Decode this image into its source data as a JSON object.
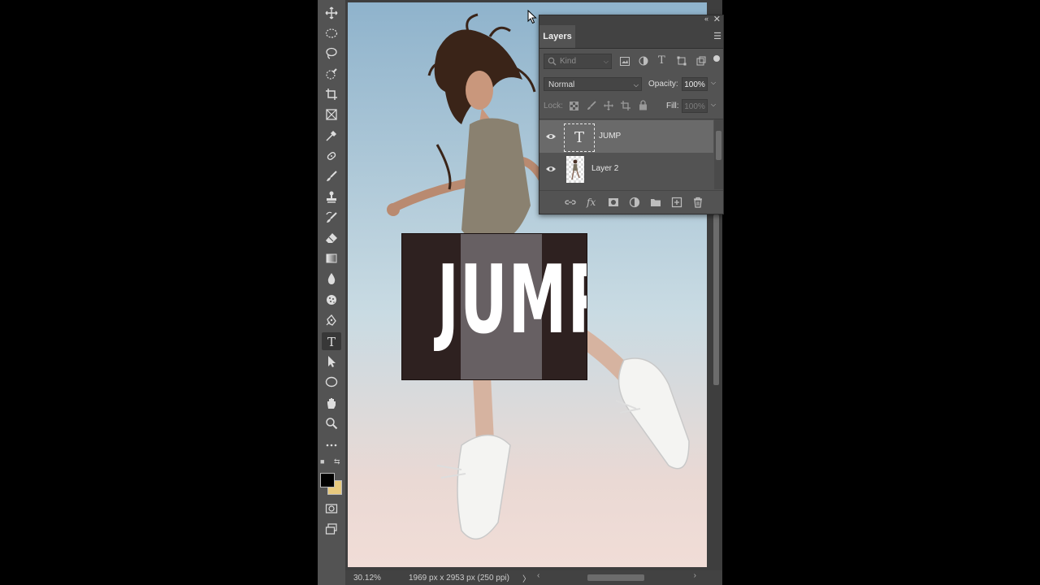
{
  "document": {
    "text_layer_content": "JUMP",
    "zoom": "30.12%",
    "doc_info": "1969 px x 2953 px (250 ppi)"
  },
  "colors": {
    "foreground": "#000000",
    "background": "#e7c97e",
    "sky_top": "#8fb3cc",
    "sky_bottom": "#f1ddd7"
  },
  "layers_panel": {
    "tab": "Layers",
    "kind_placeholder": "Kind",
    "blend_mode": "Normal",
    "opacity_label": "Opacity:",
    "opacity_value": "100%",
    "lock_label": "Lock:",
    "fill_label": "Fill:",
    "fill_value": "100%",
    "layers": [
      {
        "name": "JUMP",
        "type": "text",
        "thumb_glyph": "T",
        "visible": true,
        "selected": true
      },
      {
        "name": "Layer 2",
        "type": "pixel",
        "visible": true,
        "selected": false
      }
    ]
  },
  "toolbar": {
    "tools": [
      "move-tool",
      "marquee-tool",
      "lasso-tool",
      "quick-selection-tool",
      "crop-tool",
      "frame-tool",
      "eyedropper-tool",
      "healing-brush-tool",
      "brush-tool",
      "clone-stamp-tool",
      "history-brush-tool",
      "eraser-tool",
      "gradient-tool",
      "blur-tool",
      "dodge-tool",
      "pen-tool",
      "type-tool",
      "path-selection-tool",
      "ellipse-tool",
      "hand-tool",
      "zoom-tool",
      "more-tools"
    ],
    "active_tool": "type-tool"
  }
}
